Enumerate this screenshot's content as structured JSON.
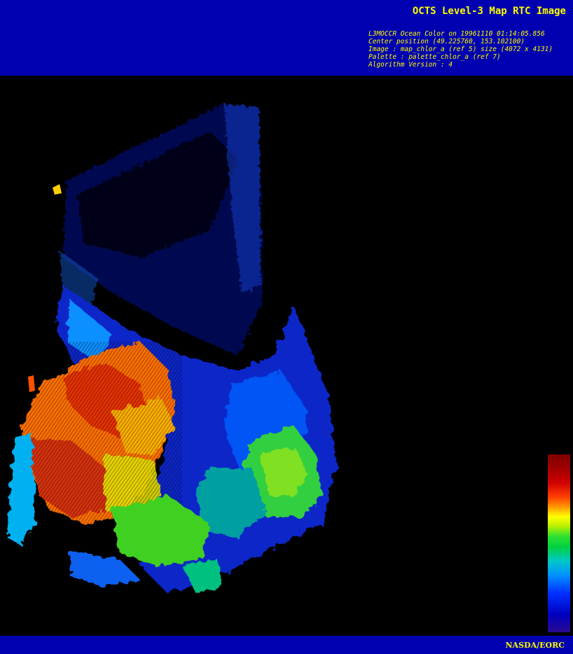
{
  "header": {
    "title": "OCTS Level-3 Map RTC Image",
    "meta_lines": [
      "L3MOCCR Ocean Color on 19961110 01:14:05.856",
      "Center position (49.225760, 153.102100)",
      "Image : map_chlor_a (ref 5) size (4072 x 4131)",
      "Palette : palette_chlor_a (ref 7)",
      "Algorithm Version : 4"
    ]
  },
  "footer": {
    "credit": "NASDA/EORC"
  },
  "colors": {
    "header_bg": "#0000b0",
    "text": "#ffff00",
    "background": "#000000"
  },
  "image": {
    "icon": "chlorophyll-map-image"
  },
  "palette": {
    "icon": "colorbar-palette"
  }
}
